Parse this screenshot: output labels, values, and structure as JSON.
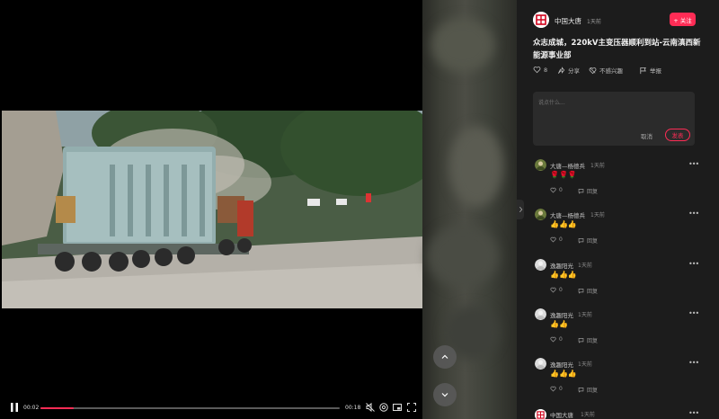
{
  "player": {
    "time_current": "00:02",
    "time_total": "00:18",
    "progress_fraction": 0.11
  },
  "author": {
    "name": "中国大唐",
    "time": "1天前",
    "follow_label": "+ 关注",
    "logo_char": "唐"
  },
  "video": {
    "title": "众志成城，220kV主变压器顺利到站-云南滇西新能源事业部"
  },
  "actions": [
    {
      "icon": "heart-icon",
      "label": "8"
    },
    {
      "icon": "share-icon",
      "label": "分享"
    },
    {
      "icon": "dislike-icon",
      "label": "不感兴趣"
    },
    {
      "icon": "report-icon",
      "label": "举报"
    }
  ],
  "comment_box": {
    "placeholder": "说点什么...",
    "cancel_label": "取消",
    "post_label": "发表"
  },
  "comments": [
    {
      "user": "大唐—杨德兵",
      "time": "1天前",
      "body": "🌹🌹🌹",
      "likes": "0",
      "reply_label": "回复"
    },
    {
      "user": "大唐—杨德兵",
      "time": "1天前",
      "body": "👍👍👍",
      "likes": "0",
      "reply_label": "回复"
    },
    {
      "user": "逸趣阳光",
      "time": "1天前",
      "body": "👍👍👍",
      "likes": "0",
      "reply_label": "回复"
    },
    {
      "user": "逸趣阳光",
      "time": "1天前",
      "body": "👍👍",
      "likes": "0",
      "reply_label": "回复"
    },
    {
      "user": "逸趣阳光",
      "time": "1天前",
      "body": "👍👍👍",
      "likes": "0",
      "reply_label": "回复"
    }
  ],
  "bottom_author": {
    "name": "中国大唐",
    "time": "1天前"
  },
  "colors": {
    "accent": "#fe2c55",
    "panel_bg": "#1c1c1c"
  }
}
